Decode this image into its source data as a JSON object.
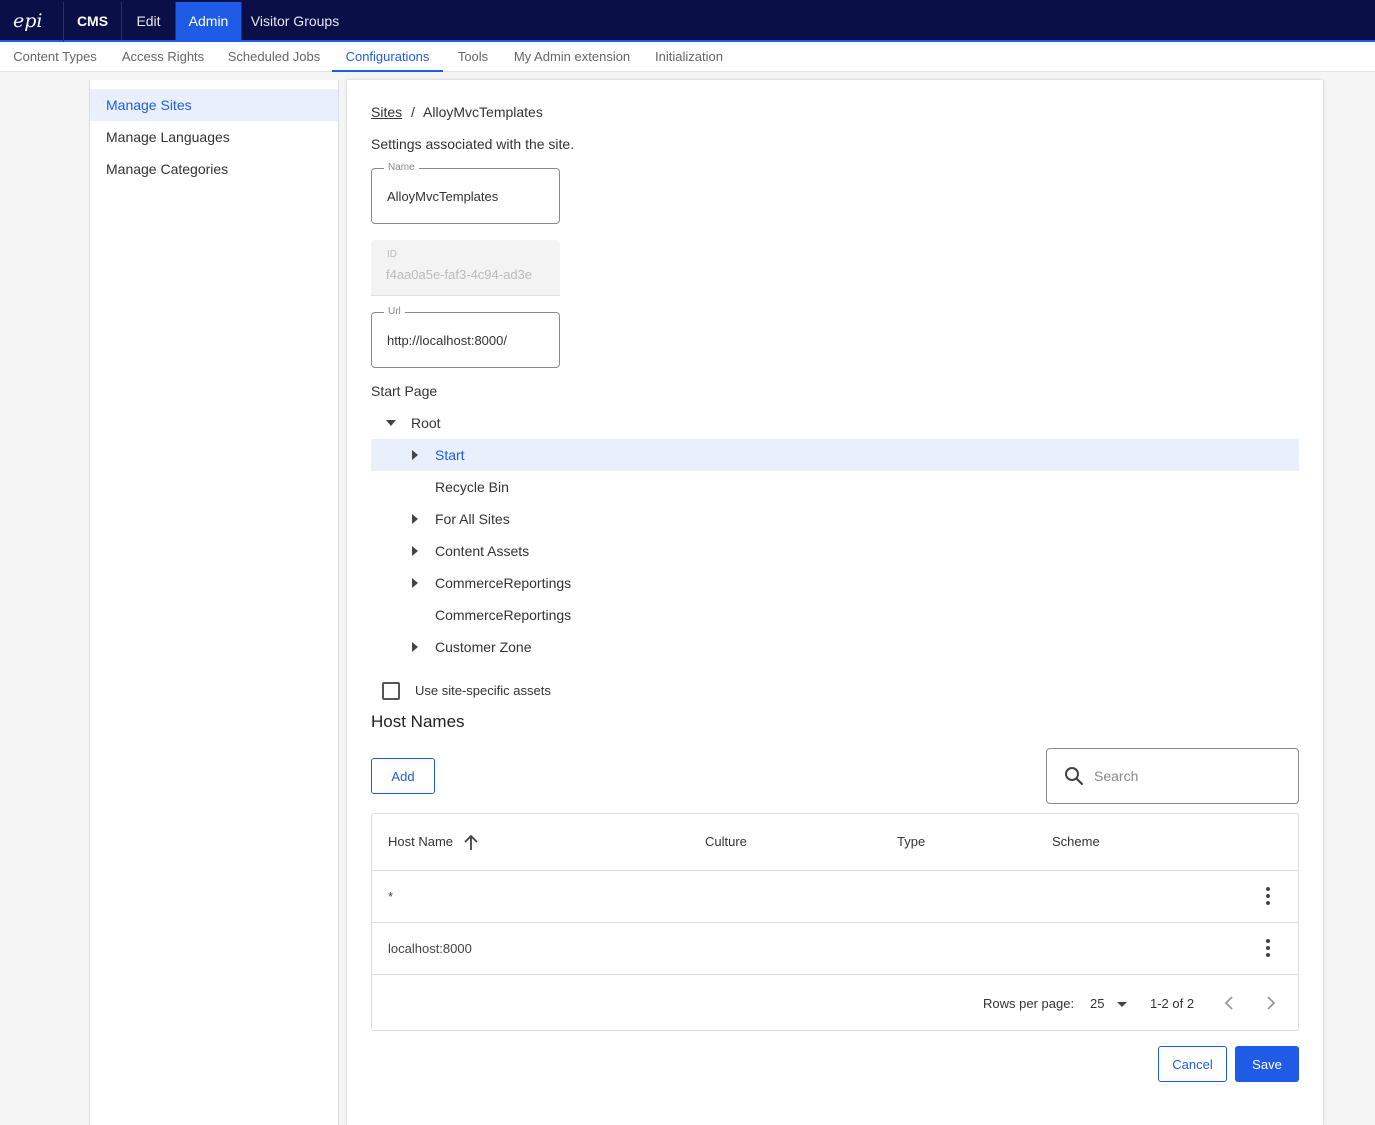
{
  "topbar": {
    "logo_text": "epi",
    "items": [
      {
        "label": "CMS"
      },
      {
        "label": "Edit"
      },
      {
        "label": "Admin",
        "active": true
      },
      {
        "label": "Visitor Groups"
      }
    ]
  },
  "subnav": {
    "items": [
      {
        "label": "Content Types"
      },
      {
        "label": "Access Rights"
      },
      {
        "label": "Scheduled Jobs"
      },
      {
        "label": "Configurations",
        "active": true
      },
      {
        "label": "Tools"
      },
      {
        "label": "My Admin extension"
      },
      {
        "label": "Initialization"
      }
    ]
  },
  "sidebar": {
    "items": [
      {
        "label": "Manage Sites",
        "active": true
      },
      {
        "label": "Manage Languages"
      },
      {
        "label": "Manage Categories"
      }
    ]
  },
  "breadcrumb": {
    "root": "Sites",
    "separator": "/",
    "current": "AlloyMvcTemplates"
  },
  "description": "Settings associated with the site.",
  "fields": {
    "name": {
      "label": "Name",
      "value": "AlloyMvcTemplates"
    },
    "id": {
      "label": "ID",
      "value": "f4aa0a5e-faf3-4c94-ad3e"
    },
    "url": {
      "label": "Url",
      "value": "http://localhost:8000/"
    }
  },
  "start_page": {
    "label": "Start Page",
    "root": "Root",
    "children": [
      {
        "label": "Start",
        "expandable": true,
        "selected": true
      },
      {
        "label": "Recycle Bin",
        "expandable": false
      },
      {
        "label": "For All Sites",
        "expandable": true
      },
      {
        "label": "Content Assets",
        "expandable": true
      },
      {
        "label": "CommerceReportings",
        "expandable": true
      },
      {
        "label": "CommerceReportings",
        "expandable": false
      },
      {
        "label": "Customer Zone",
        "expandable": true
      }
    ]
  },
  "site_assets_checkbox": {
    "label": "Use site-specific assets",
    "checked": false
  },
  "host_names": {
    "title": "Host Names",
    "add_label": "Add",
    "search_placeholder": "Search",
    "columns": [
      "Host Name",
      "Culture",
      "Type",
      "Scheme"
    ],
    "rows": [
      {
        "host": "*",
        "culture": "",
        "type": "",
        "scheme": ""
      },
      {
        "host": "localhost:8000",
        "culture": "",
        "type": "",
        "scheme": ""
      }
    ],
    "pagination": {
      "rows_per_page_label": "Rows per page:",
      "rows_per_page": "25",
      "range": "1-2 of 2"
    }
  },
  "actions": {
    "cancel": "Cancel",
    "save": "Save"
  },
  "colors": {
    "accent": "#1f5ce6",
    "topbar": "#0a0f47",
    "selected_bg": "#eaf0fb"
  }
}
